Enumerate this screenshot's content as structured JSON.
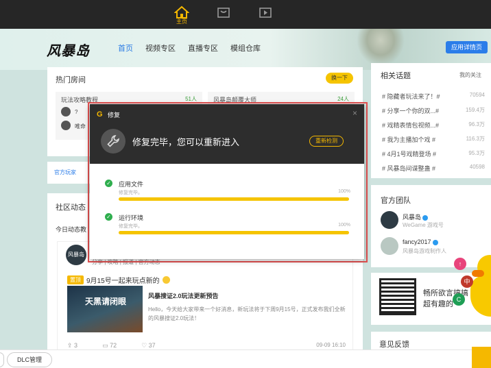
{
  "topbar": {
    "home_label": "主页"
  },
  "nav": {
    "logo": "风暴岛",
    "tabs": [
      "首页",
      "视频专区",
      "直播专区",
      "模组仓库"
    ],
    "follow_button": "应用详情页"
  },
  "hot_rooms": {
    "title": "热门房间",
    "change_button": "换一下",
    "rooms": [
      {
        "title": "玩法攻略教程",
        "count": "51人",
        "users": [
          "?",
          "唯命"
        ]
      },
      {
        "title": "风暴岛颠覆大师",
        "count": "24人",
        "users": [
          "",
          ""
        ]
      }
    ]
  },
  "announcement": {
    "text": "官方玩家"
  },
  "community": {
    "title": "社区动态",
    "today": "今日动态教",
    "post": {
      "avatar_text": "风暴岛",
      "tags": "分享 | 攻略 | 报道 | 官方动态",
      "badge": "置顶",
      "headline": "9月15号一起来玩点新的",
      "thumb_text": "天黑请闭眼",
      "article_title": "风暴搜证2.0玩法更新预告",
      "article_desc": "Hello，今天给大家带来一个好消息，新玩法将于下周9月15号，正式发布我们全新的风暴搜证2.0玩法！",
      "stats": {
        "shares": "3",
        "comments": "72",
        "likes": "37"
      },
      "time": "09-09 16:10"
    }
  },
  "topics": {
    "title": "相关话题",
    "my_follow": "我的关注",
    "items": [
      {
        "label": "# 隐藏者玩法来了！#",
        "count": "70594"
      },
      {
        "label": "# 分享一个你的双...#",
        "count": "159.4万"
      },
      {
        "label": "# 戏精表情包视频...#",
        "count": "96.3万"
      },
      {
        "label": "# 我为主播加个戏 #",
        "count": "116.3万"
      },
      {
        "label": "# 4月1号戏精登场 #",
        "count": "95.3万"
      },
      {
        "label": "# 风暴岛间谍整蛊 #",
        "count": "40598"
      }
    ]
  },
  "team": {
    "title": "官方团队",
    "members": [
      {
        "name": "风暴岛",
        "desc": "WeGame 游戏号"
      },
      {
        "name": "fancy2017",
        "desc": "风暴岛游戏制作人"
      }
    ]
  },
  "qr": {
    "line1": "畅所欲言搞搞",
    "line2": "超有趣的"
  },
  "feedback": {
    "title": "意见反馈"
  },
  "float_icons": {
    "top": "↑",
    "mid": "中",
    "bottom": "C"
  },
  "bottom": {
    "dlc_button": "DLC管理"
  },
  "modal": {
    "title": "修复",
    "message": "修复完毕，您可以重新进入",
    "recheck_button": "重新检测",
    "close": "×",
    "items": [
      {
        "name": "应用文件",
        "status": "修复完毕。",
        "percent": "100%",
        "progress": 1.0
      },
      {
        "name": "运行环境",
        "status": "修复完毕。",
        "percent": "100%",
        "progress": 1.0
      }
    ]
  },
  "colors": {
    "accent": "#f5b800",
    "link": "#2b7de9",
    "success": "#2fae4e",
    "highlight": "#e45050"
  }
}
